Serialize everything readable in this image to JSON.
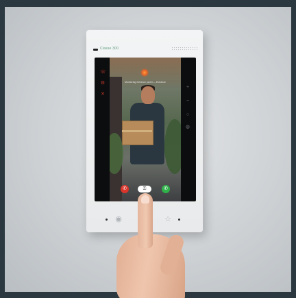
{
  "device": {
    "brand": "Classe 300",
    "screen": {
      "notification_text": "Monitoring entrance panel — Entrance",
      "left_icons": [
        "phone-icon",
        "gear-icon",
        "mute-icon"
      ],
      "right_icons": [
        "plus-icon",
        "minus-icon",
        "camera-icon",
        "mic-icon"
      ],
      "hangup_icon": "hangup-icon",
      "answer_icon": "answer-icon",
      "door_icon": "key-icon"
    },
    "bottom_buttons": [
      "eye-icon",
      "intercom-icon",
      "star-icon"
    ],
    "colors": {
      "hangup": "#d9352b",
      "answer": "#2fb24a",
      "led": "#e0632a",
      "logo": "#5a9a7a"
    }
  }
}
